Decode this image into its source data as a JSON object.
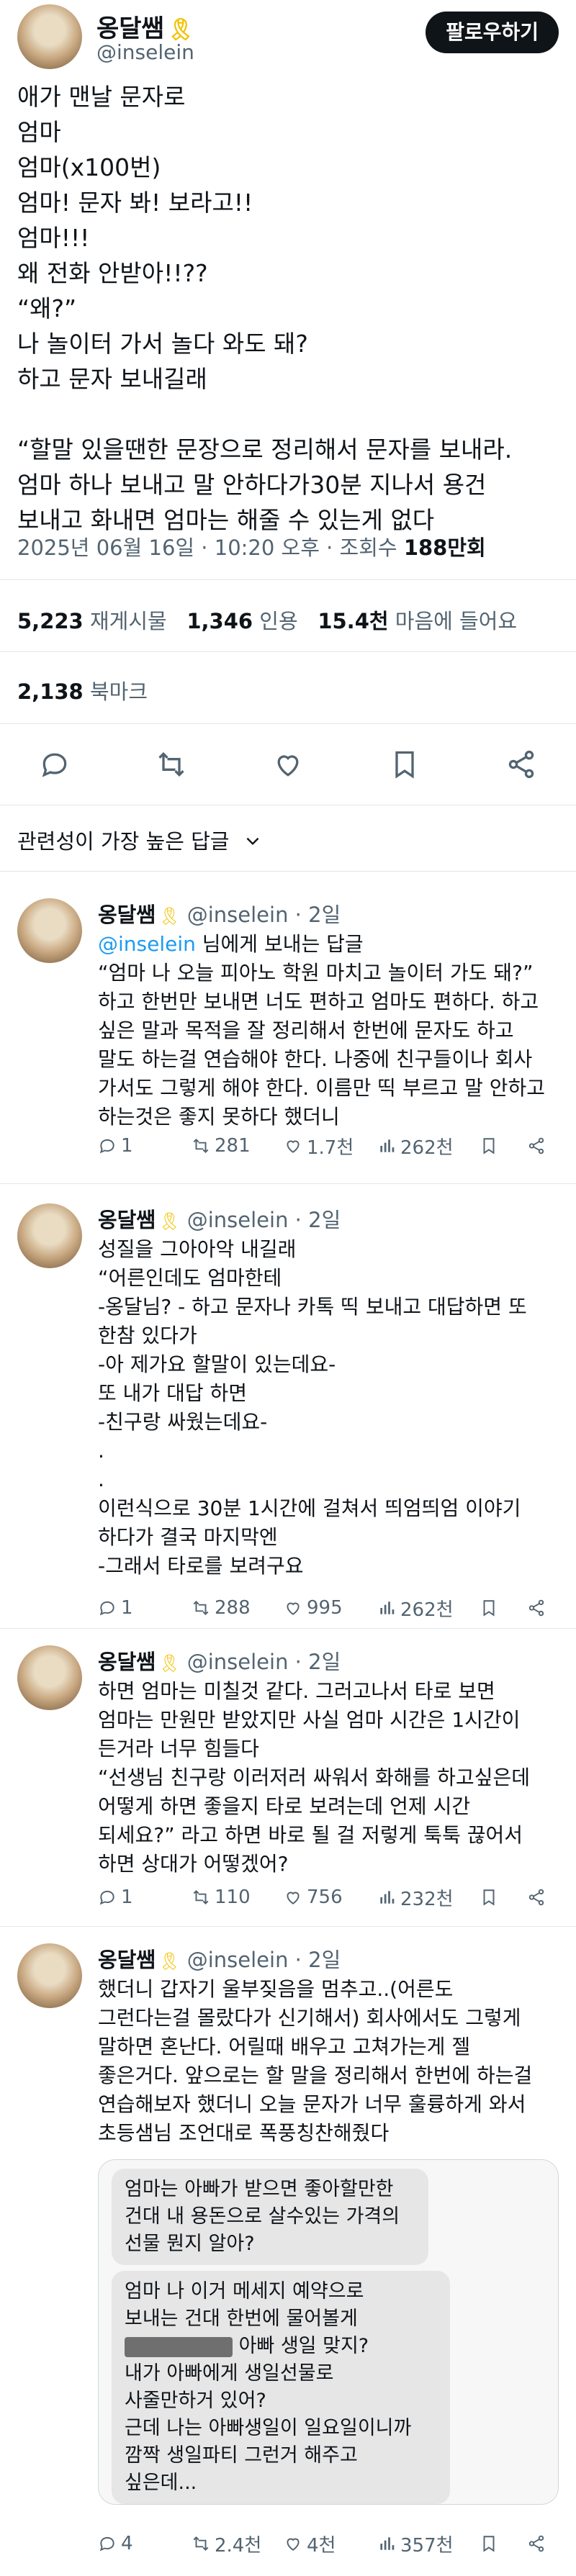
{
  "post": {
    "display_name": "옹달쌤",
    "ribbon_icon": "yellow-ribbon-icon",
    "handle": "@inselein",
    "follow_label": "팔로우하기",
    "lines": [
      "애가 맨날 문자로",
      "엄마",
      "엄마(x100번)",
      "엄마! 문자 봐! 보라고!!",
      "엄마!!!",
      "왜 전화 안받아!!??",
      "“왜?”",
      "나 놀이터 가서 놀다 와도 돼?",
      "하고 문자 보내길래",
      "",
      "“할말 있을땐한 문장으로 정리해서 문자를 보내라.",
      "엄마 하나 보내고 말 안하다가30분 지나서 용건",
      "보내고 화내면 엄마는 해줄 수 있는게 없다"
    ],
    "timestamp": "2025년 06월 16일 · 10:20 오후 · 조회수 ",
    "views": "188만회",
    "reposts_count": "5,223",
    "reposts_label": "재게시물",
    "quotes_count": "1,346",
    "quotes_label": "인용",
    "likes_count": "15.4천",
    "likes_label": "마음에 들어요",
    "bookmarks_count": "2,138",
    "bookmarks_label": "북마크"
  },
  "actions": {
    "icons": [
      "reply-icon",
      "repost-icon",
      "like-icon",
      "bookmark-icon",
      "share-icon"
    ]
  },
  "sort": {
    "label": "관련성이 가장 높은 답글"
  },
  "replies": [
    {
      "name": "옹달쌤",
      "handle": "@inselein",
      "age": " · 2일",
      "reply_to_mention": "@inselein",
      "reply_to_suffix": " 님에게 보내는 답글",
      "lines": [
        "“엄마 나 오늘 피아노 학원 마치고 놀이터 가도 돼?”",
        "하고 한번만 보내면 너도 편하고 엄마도 편하다. 하고",
        "싶은 말과 목적을 잘 정리해서 한번에 문자도 하고",
        "말도 하는걸 연습해야 한다. 나중에 친구들이나 회사",
        "가서도 그렇게 해야 한다. 이름만 띡 부르고 말 안하고",
        "하는것은 좋지 못하다 했더니"
      ],
      "replies": "1",
      "reposts": "281",
      "likes": "1.7천",
      "views": "262천"
    },
    {
      "name": "옹달쌤",
      "handle": "@inselein",
      "age": " · 2일",
      "lines": [
        "성질을 그아아악 내길래",
        "“어른인데도 엄마한테",
        "-옹달님? - 하고 문자나 카톡 띡 보내고 대답하면 또",
        "한참 있다가",
        "-아 제가요 할말이 있는데요-",
        " 또 내가 대답 하면",
        "-친구랑 싸웠는데요-",
        ".",
        ".",
        "이런식으로 30분 1시간에 걸쳐서 띄엄띄엄 이야기",
        "하다가 결국 마지막엔",
        "-그래서 타로를 보려구요"
      ],
      "replies": "1",
      "reposts": "288",
      "likes": "995",
      "views": "262천"
    },
    {
      "name": "옹달쌤",
      "handle": "@inselein",
      "age": " · 2일",
      "lines": [
        "하면 엄마는 미칠것 같다. 그러고나서 타로 보면",
        "엄마는 만원만 받았지만 사실 엄마 시간은 1시간이",
        "든거라 너무 힘들다",
        "“선생님 친구랑 이러저러 싸워서 화해를 하고싶은데",
        "어떻게 하면 좋을지 타로 보려는데 언제 시간",
        "되세요?” 라고 하면 바로 될 걸 저렇게 툭툭 끊어서",
        "하면 상대가 어떻겠어?"
      ],
      "replies": "1",
      "reposts": "110",
      "likes": "756",
      "views": "232천"
    },
    {
      "name": "옹달쌤",
      "handle": "@inselein",
      "age": " · 2일",
      "lines": [
        "했더니 갑자기 울부짖음을 멈추고..(어른도",
        "그런다는걸 몰랐다가 신기해서) 회사에서도 그렇게",
        "말하면 혼난다. 어릴때 배우고 고쳐가는게 젤",
        "좋은거다. 앞으로는 할 말을 정리해서 한번에 하는걸",
        "연습해보자 했더니 오늘 문자가 너무 훌륭하게 와서",
        "초등샘님 조언대로 폭풍칭찬해줬다"
      ],
      "image_bubble_1": [
        "엄마는 아빠가 받으면 좋아할만한",
        "건대 내 용돈으로 살수있는 가격의",
        "선물 뭔지 알아?"
      ],
      "image_bubble_2": [
        "엄마 나 이거 메세지 예약으로",
        "보내는 건대 한번에 물어볼게",
        " 아빠 생일 맞지?",
        "내가 아빠에게 생일선물로",
        "사줄만하거 있어?",
        "근데 나는 아빠생일이 일요일이니까",
        "깜짝 생일파티 그런거 해주고",
        "싶은데..."
      ],
      "replies": "4",
      "reposts": "2.4천",
      "likes": "4천",
      "views": "357천"
    }
  ]
}
